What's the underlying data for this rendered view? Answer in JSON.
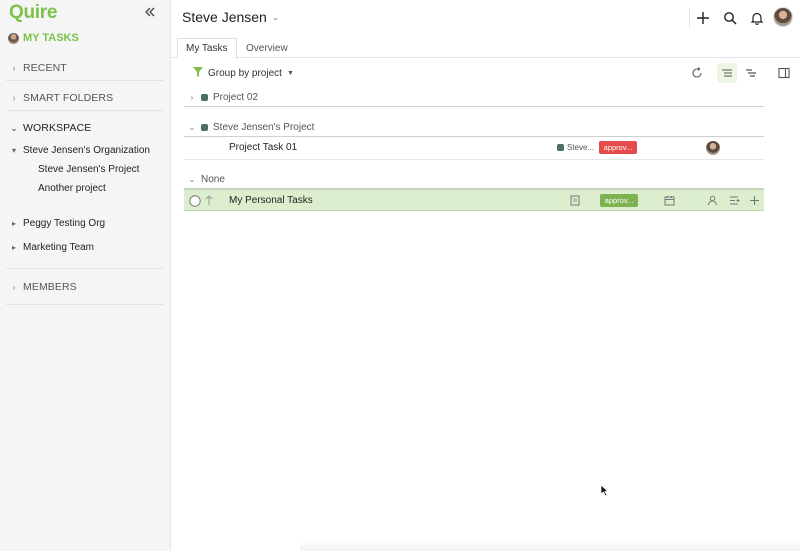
{
  "app": {
    "logo": "Quire",
    "accent": "#7cc24a"
  },
  "sidebar": {
    "my_tasks": "MY TASKS",
    "recent": "RECENT",
    "smart_folders": "SMART FOLDERS",
    "workspace": "WORKSPACE",
    "organizations": [
      {
        "name": "Steve Jensen's Organization",
        "projects": [
          "Steve Jensen's Project",
          "Another project"
        ]
      },
      {
        "name": "Peggy Testing Org"
      },
      {
        "name": "Marketing Team"
      }
    ],
    "members": "MEMBERS"
  },
  "header": {
    "title": "Steve Jensen"
  },
  "tabs": [
    {
      "label": "My Tasks",
      "active": true
    },
    {
      "label": "Overview",
      "active": false
    }
  ],
  "toolbar": {
    "group_by": "Group by project"
  },
  "groups": [
    {
      "name": "Project 02"
    },
    {
      "name": "Steve Jensen's Project"
    },
    {
      "name": "None"
    }
  ],
  "tasks": [
    {
      "name": "Project Task 01",
      "project": "Steve...",
      "status": "approv...",
      "status_color": "#e54b4b"
    },
    {
      "name": "My Personal Tasks",
      "status": "approv...",
      "status_color": "#7cb24f"
    }
  ]
}
